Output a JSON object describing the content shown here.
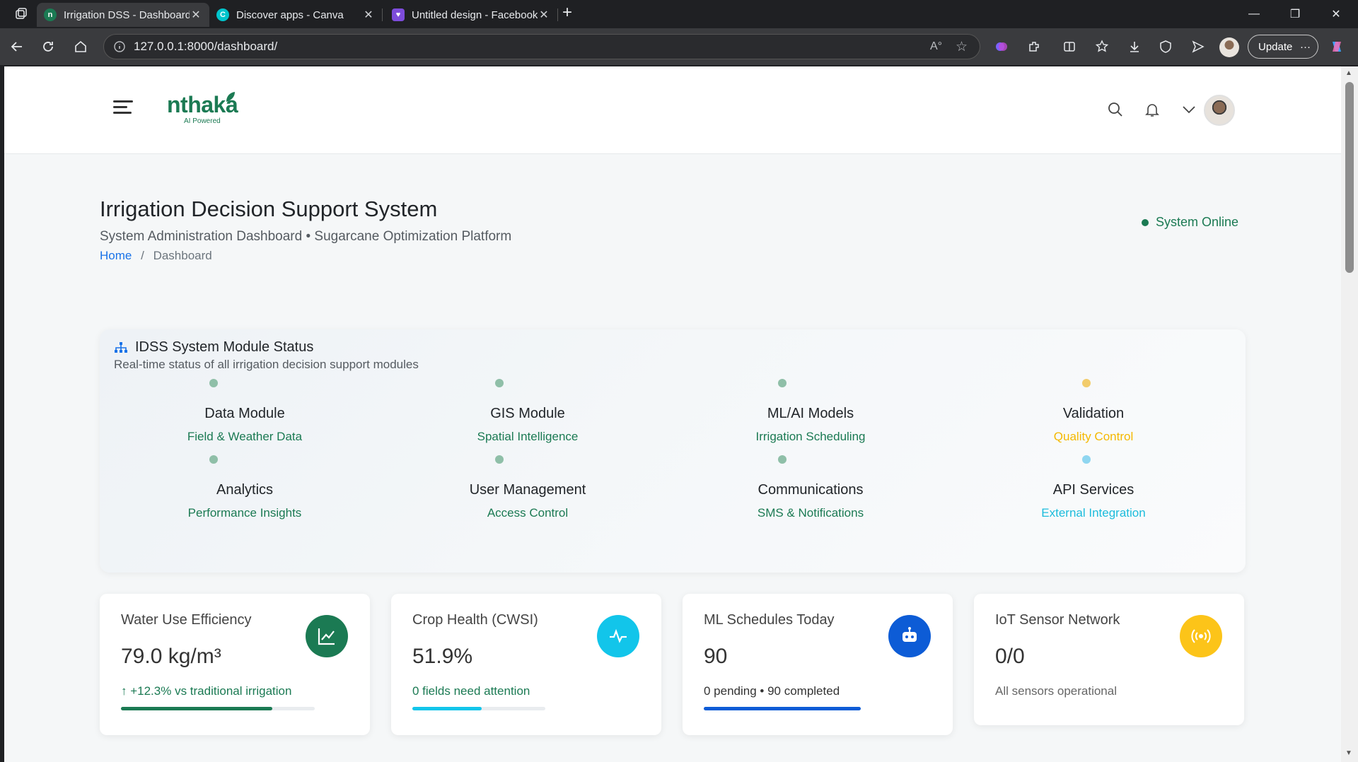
{
  "browser": {
    "tabs": [
      {
        "title": "Irrigation DSS - Dashboard",
        "active": true
      },
      {
        "title": "Discover apps - Canva",
        "active": false
      },
      {
        "title": "Untitled design - Facebook Post",
        "active": false
      }
    ],
    "url": "127.0.0.1:8000/dashboard/",
    "update_label": "Update"
  },
  "header": {
    "logo_text": "nthaka",
    "logo_tagline": "AI Powered"
  },
  "page": {
    "title": "Irrigation Decision Support System",
    "subtitle": "System Administration Dashboard • Sugarcane Optimization Platform",
    "breadcrumb_home": "Home",
    "breadcrumb_sep": "/",
    "breadcrumb_current": "Dashboard",
    "status": "System Online"
  },
  "modules": {
    "title": "IDSS System Module Status",
    "subtitle": "Real-time status of all irrigation decision support modules",
    "items": [
      {
        "name": "Data Module",
        "desc": "Field & Weather Data",
        "color": "#1b7a53",
        "dot": "#8fbfa8"
      },
      {
        "name": "GIS Module",
        "desc": "Spatial Intelligence",
        "color": "#1b7a53",
        "dot": "#8fbfa8"
      },
      {
        "name": "ML/AI Models",
        "desc": "Irrigation Scheduling",
        "color": "#1b7a53",
        "dot": "#8fbfa8"
      },
      {
        "name": "Validation",
        "desc": "Quality Control",
        "color": "#f5b800",
        "dot": "#f2cc6b"
      },
      {
        "name": "Analytics",
        "desc": "Performance Insights",
        "color": "#1b7a53",
        "dot": "#8fbfa8"
      },
      {
        "name": "User Management",
        "desc": "Access Control",
        "color": "#1b7a53",
        "dot": "#8fbfa8"
      },
      {
        "name": "Communications",
        "desc": "SMS & Notifications",
        "color": "#1b7a53",
        "dot": "#8fbfa8"
      },
      {
        "name": "API Services",
        "desc": "External Integration",
        "color": "#1cbcdc",
        "dot": "#8fd6f0"
      }
    ]
  },
  "stats": [
    {
      "label": "Water Use Efficiency",
      "value": "79.0 kg/m³",
      "footer": "↑ +12.3% vs traditional irrigation",
      "footer_color": "#1b7a53",
      "icon": "chart-line-icon",
      "icon_bg": "#1b7a53",
      "bar_color": "#1b7a53",
      "progress": 0.78
    },
    {
      "label": "Crop Health (CWSI)",
      "value": "51.9%",
      "footer": "0 fields need attention",
      "footer_color": "#1b7a53",
      "icon": "pulse-icon",
      "icon_bg": "#12c5ea",
      "bar_color": "#12c5ea",
      "progress": 0.519
    },
    {
      "label": "ML Schedules Today",
      "value": "90",
      "footer": "0 pending • 90 completed",
      "footer_color": "#333333",
      "icon": "robot-icon",
      "icon_bg": "#0d5cd6",
      "bar_color": "#0d5cd6",
      "progress": 1.0
    },
    {
      "label": "IoT Sensor Network",
      "value": "0/0",
      "footer": "All sensors operational",
      "footer_color": "#666666",
      "icon": "broadcast-icon",
      "icon_bg": "#fcc419",
      "bar_color": null,
      "progress": null
    }
  ]
}
